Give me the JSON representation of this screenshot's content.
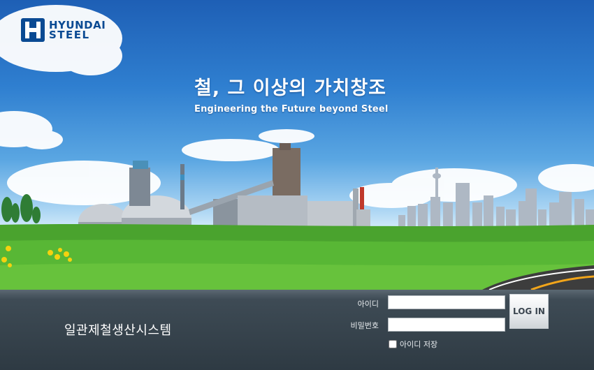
{
  "brand": {
    "logo_line1": "HYUNDAI",
    "logo_line2": "STEEL",
    "logo_color": "#0a4a93"
  },
  "hero": {
    "slogan_ko": "철, 그 이상의 가치창조",
    "slogan_en": "Engineering the Future beyond Steel"
  },
  "login": {
    "system_name": "일관제철생산시스템",
    "id_label": "아이디",
    "pw_label": "비밀번호",
    "id_value": "",
    "pw_value": "",
    "button_label": "LOG IN",
    "save_id_label": "아이디 저장",
    "save_id_checked": false
  },
  "colors": {
    "bar_background": "#2e3a43",
    "sky": "#1e5fb5",
    "grass": "#4aa32e"
  }
}
